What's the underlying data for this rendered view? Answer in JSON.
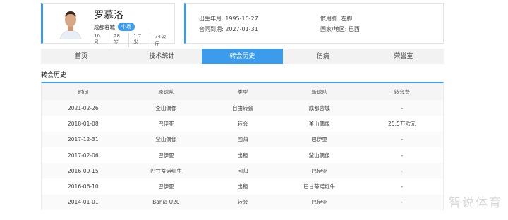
{
  "player": {
    "name": "罗慕洛",
    "team": "成都蓉城",
    "position": "中场",
    "number": "10号",
    "age": "28岁",
    "height": "1.7米",
    "weight": "74公斤"
  },
  "info": {
    "birth": "出生年月: 1995-10-27",
    "contract": "合同到期: 2027-01-31",
    "foot": "惯用脚: 左脚",
    "nation": "国家/地区: 巴西"
  },
  "tabs": [
    "首页",
    "技术统计",
    "转会历史",
    "伤病",
    "荣誉室"
  ],
  "section_title": "转会历史",
  "table": {
    "headers": [
      "时间",
      "原球队",
      "类型",
      "新球队",
      "转会费"
    ],
    "rows": [
      [
        "2021-02-26",
        "釜山偶像",
        "自由转会",
        "成都蓉城",
        "-"
      ],
      [
        "2018-01-08",
        "巴伊亚",
        "转会",
        "釜山偶像",
        "25.5万欧元"
      ],
      [
        "2017-12-31",
        "釜山偶像",
        "回归",
        "巴伊亚",
        "-"
      ],
      [
        "2017-02-06",
        "巴伊亚",
        "出租",
        "釜山偶像",
        "-"
      ],
      [
        "2016-09-15",
        "巴甘蒂诺红牛",
        "回归",
        "巴伊亚",
        "-"
      ],
      [
        "2016-06-10",
        "巴伊亚",
        "出租",
        "巴甘蒂诺红牛",
        "-"
      ],
      [
        "2014-01-01",
        "Bahia U20",
        "转会",
        "巴伊亚",
        "-"
      ]
    ]
  },
  "watermark": "智说体育",
  "colors": {
    "accent": "#3d9bec"
  }
}
